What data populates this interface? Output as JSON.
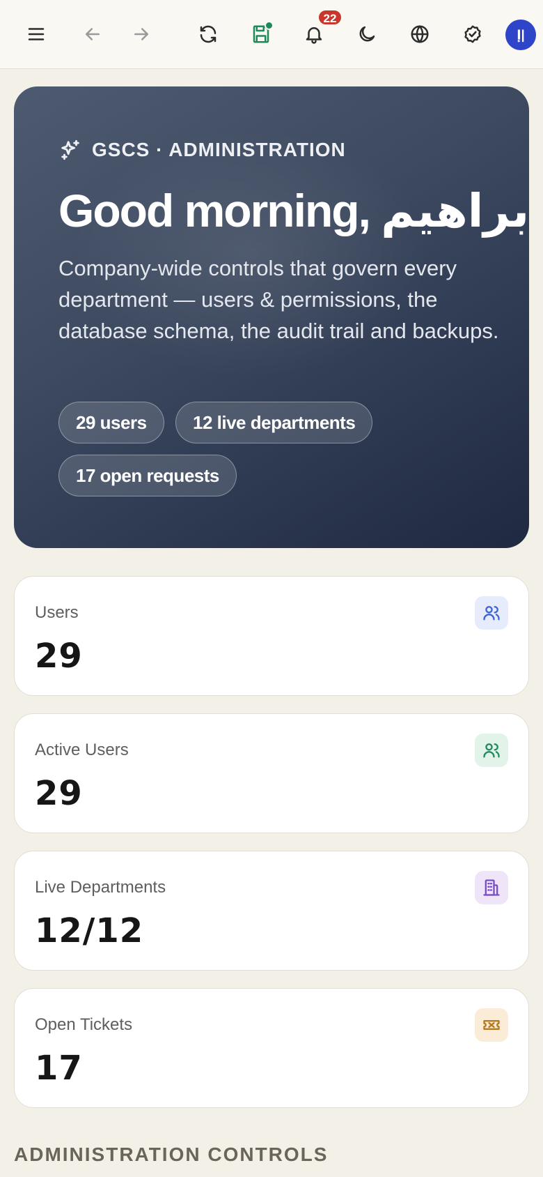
{
  "topbar": {
    "icons": [
      "menu-icon",
      "back-arrow-icon",
      "forward-arrow-icon",
      "refresh-icon",
      "save-icon",
      "bell-icon",
      "moon-icon",
      "globe-icon",
      "verified-badge-icon"
    ],
    "notification_count": "22",
    "avatar_initials": "إ|",
    "save_status_color": "#1e8a5a",
    "avatar_color": "#2f45c9"
  },
  "hero": {
    "eyebrow": "GSCS · ADMINISTRATION",
    "greeting": "Good morning, إبراهيم",
    "description": "Company-wide controls that govern every department — users & permissions, the database schema, the audit trail and backups.",
    "chips": [
      "29 users",
      "12 live departments",
      "17 open requests"
    ]
  },
  "stats": [
    {
      "label": "Users",
      "value": "29",
      "icon": "users-icon",
      "accent": "#3b63d6",
      "accent_bg": "#e6ecfb"
    },
    {
      "label": "Active Users",
      "value": "29",
      "icon": "users-icon",
      "accent": "#1f8a5b",
      "accent_bg": "#e2f3ea"
    },
    {
      "label": "Live Departments",
      "value": "12/12",
      "icon": "building-icon",
      "accent": "#7a4fc2",
      "accent_bg": "#eee6f8"
    },
    {
      "label": "Open Tickets",
      "value": "17",
      "icon": "ticket-icon",
      "accent": "#b7791f",
      "accent_bg": "#faecd6"
    }
  ],
  "section": {
    "heading": "ADMINISTRATION CONTROLS"
  }
}
